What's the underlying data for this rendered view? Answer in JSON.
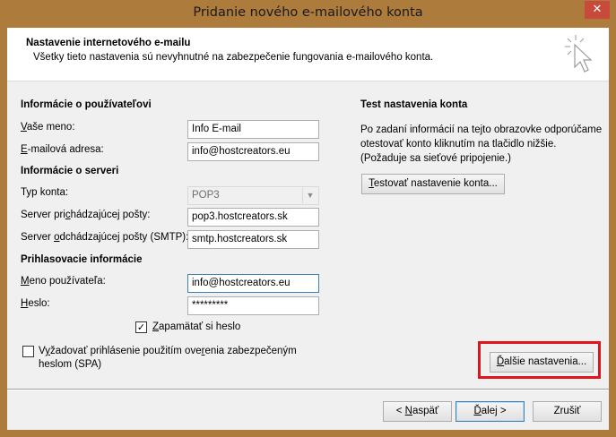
{
  "window": {
    "title": "Pridanie nového e-mailového konta",
    "close_glyph": "✕"
  },
  "header": {
    "title": "Nastavenie internetového e-mailu",
    "subtitle": "Všetky tieto nastavenia sú nevyhnutné na zabezpečenie fungovania e-mailového konta."
  },
  "user_info": {
    "section_title": "Informácie o používateľovi",
    "name_label_pre": "",
    "name_label_key": "V",
    "name_label_post": "aše meno:",
    "name_value": "Info E-mail",
    "email_label_pre": "",
    "email_label_key": "E",
    "email_label_post": "-mailová adresa:",
    "email_value": "info@hostcreators.eu"
  },
  "server_info": {
    "section_title": "Informácie o serveri",
    "type_label": "Typ konta:",
    "type_value": "POP3",
    "incoming_label_pre": "Server pri",
    "incoming_label_key": "c",
    "incoming_label_post": "hádzajúcej pošty:",
    "incoming_value": "pop3.hostcreators.sk",
    "outgoing_label_pre": "Server ",
    "outgoing_label_key": "o",
    "outgoing_label_post": "dchádzajúcej pošty (SMTP):",
    "outgoing_value": "smtp.hostcreators.sk"
  },
  "login_info": {
    "section_title": "Prihlasovacie informácie",
    "username_label_pre": "",
    "username_label_key": "M",
    "username_label_post": "eno používateľa:",
    "username_value": "info@hostcreators.eu",
    "password_label_pre": "",
    "password_label_key": "H",
    "password_label_post": "eslo:",
    "password_value": "*********",
    "remember_pre": "",
    "remember_key": "Z",
    "remember_post": "apamätať si heslo",
    "remember_checked": true,
    "check_glyph": "✓",
    "spa_pre": "V",
    "spa_key": "y",
    "spa_post": "žadovať prihlásenie použitím ove",
    "spa_key2": "r",
    "spa_post2": "enia zabezpečeným",
    "spa_line2": "heslom (SPA)",
    "spa_checked": false
  },
  "test": {
    "section_title": "Test nastavenia konta",
    "description": "Po zadaní informácií na tejto obrazovke odporúčame otestovať konto kliknutím na tlačidlo nižšie. (Požaduje sa sieťové pripojenie.)",
    "test_button_pre": "",
    "test_button_key": "T",
    "test_button_post": "estovať nastavenie konta..."
  },
  "more_settings": {
    "pre": "",
    "key": "Ď",
    "post": "alšie nastavenia...",
    "highlight_color": "#e0141a"
  },
  "footer": {
    "back_pre": "< ",
    "back_key": "N",
    "back_post": "aspäť",
    "next_pre": "",
    "next_key": "Ď",
    "next_post": "alej >",
    "cancel_label": "Zrušiť"
  },
  "icons": {
    "header_icon": "cursor-click-icon",
    "combo_arrow": "chevron-down-icon"
  },
  "colors": {
    "frame": "#ad7b3b",
    "close": "#c74a3a",
    "focus": "#3c7fb1"
  }
}
